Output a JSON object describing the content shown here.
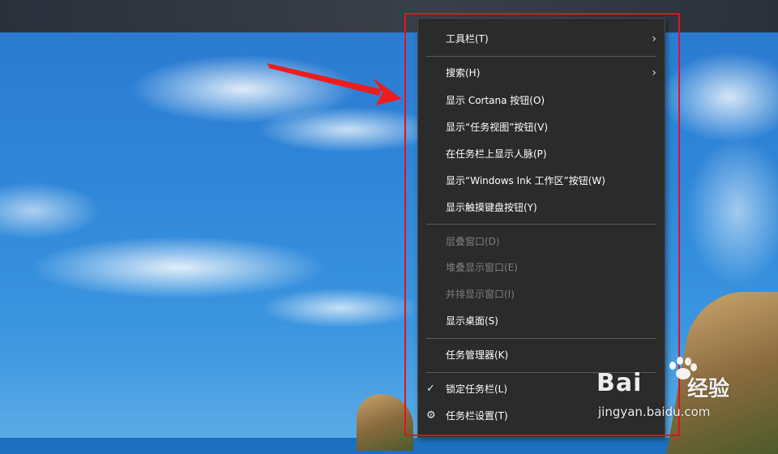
{
  "context_menu": {
    "items": [
      {
        "label": "工具栏(T)",
        "disabled": false,
        "submenu": true
      },
      {
        "label": "搜索(H)",
        "disabled": false,
        "submenu": true
      },
      {
        "label": "显示 Cortana 按钮(O)",
        "disabled": false
      },
      {
        "label": "显示“任务视图”按钮(V)",
        "disabled": false
      },
      {
        "label": "在任务栏上显示人脉(P)",
        "disabled": false
      },
      {
        "label": "显示“Windows Ink 工作区”按钮(W)",
        "disabled": false
      },
      {
        "label": "显示触摸键盘按钮(Y)",
        "disabled": false
      },
      {
        "label": "层叠窗口(D)",
        "disabled": true
      },
      {
        "label": "堆叠显示窗口(E)",
        "disabled": true
      },
      {
        "label": "并排显示窗口(I)",
        "disabled": true
      },
      {
        "label": "显示桌面(S)",
        "disabled": false
      },
      {
        "label": "任务管理器(K)",
        "disabled": false
      },
      {
        "label": "锁定任务栏(L)",
        "disabled": false,
        "checked": true
      },
      {
        "label": "任务栏设置(T)",
        "disabled": false,
        "icon": "gear-icon"
      }
    ],
    "submenu_glyph": "›",
    "check_glyph": "✓",
    "gear_glyph": "⚙"
  },
  "watermark": {
    "brand": "Bai",
    "brand_cn": "经验",
    "url": "jingyan.baidu.com"
  },
  "colors": {
    "highlight": "#e0131e",
    "arrow": "#ee1c1c",
    "menu_bg": "#2b2b2b",
    "disabled_text": "#7e7e7e"
  }
}
